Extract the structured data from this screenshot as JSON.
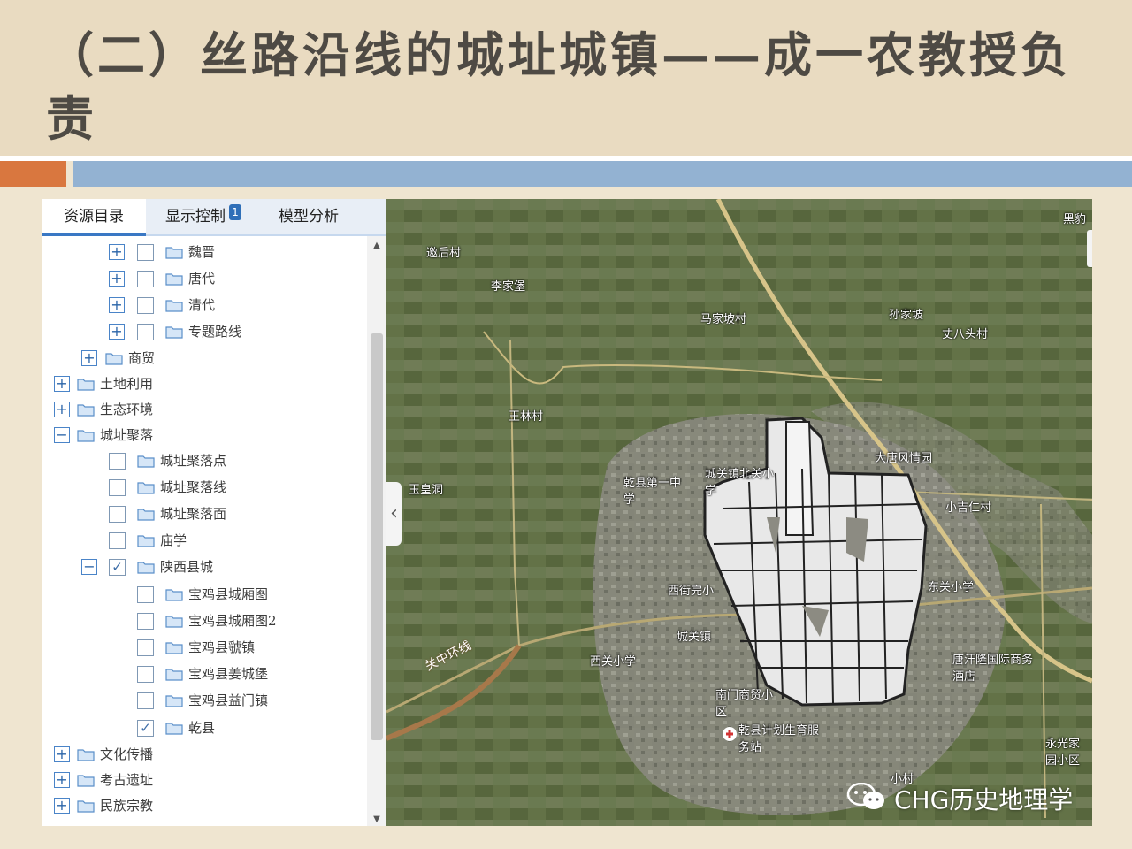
{
  "slide": {
    "title": "（二）丝路沿线的城址城镇——成一农教授负责"
  },
  "panel": {
    "tabs": [
      {
        "label": "资源目录",
        "active": true
      },
      {
        "label": "显示控制",
        "badge": "1"
      },
      {
        "label": "模型分析"
      }
    ],
    "tree": [
      {
        "label": "魏晋",
        "expander": "+",
        "checkbox": true,
        "checked": false
      },
      {
        "label": "唐代",
        "expander": "+",
        "checkbox": true,
        "checked": false
      },
      {
        "label": "清代",
        "expander": "+",
        "checkbox": true,
        "checked": false
      },
      {
        "label": "专题路线",
        "expander": "+",
        "checkbox": true,
        "checked": false
      },
      {
        "label": "商贸",
        "expander": "+",
        "checkbox": false
      },
      {
        "label": "土地利用",
        "expander": "+",
        "checkbox": false
      },
      {
        "label": "生态环境",
        "expander": "+",
        "checkbox": false
      },
      {
        "label": "城址聚落",
        "expander": "−",
        "checkbox": false
      },
      {
        "label": "城址聚落点",
        "checkbox": true,
        "checked": false
      },
      {
        "label": "城址聚落线",
        "checkbox": true,
        "checked": false
      },
      {
        "label": "城址聚落面",
        "checkbox": true,
        "checked": false
      },
      {
        "label": "庙学",
        "checkbox": true,
        "checked": false
      },
      {
        "label": "陕西县城",
        "expander": "−",
        "checkbox": true,
        "checked": true
      },
      {
        "label": "宝鸡县城厢图",
        "checkbox": true,
        "checked": false
      },
      {
        "label": "宝鸡县城厢图2",
        "checkbox": true,
        "checked": false
      },
      {
        "label": "宝鸡县虢镇",
        "checkbox": true,
        "checked": false
      },
      {
        "label": "宝鸡县姜城堡",
        "checkbox": true,
        "checked": false
      },
      {
        "label": "宝鸡县益门镇",
        "checkbox": true,
        "checked": false
      },
      {
        "label": "乾县",
        "checkbox": true,
        "checked": true
      },
      {
        "label": "文化传播",
        "expander": "+",
        "checkbox": false
      },
      {
        "label": "考古遗址",
        "expander": "+",
        "checkbox": false
      },
      {
        "label": "民族宗教",
        "expander": "+",
        "checkbox": false
      }
    ],
    "icons": {
      "folder": "folder-icon",
      "expand": "plus-icon",
      "collapse": "minus-icon",
      "check": "check-icon"
    }
  },
  "map": {
    "labels": {
      "l1": "邀后村",
      "l2": "李家堡",
      "l3": "马家坡村",
      "l4": "孙家坡",
      "l5": "丈八头村",
      "l6": "王林村",
      "l7": "大唐风情园",
      "l8": "玉皇洞",
      "l9": "乾县第一中学",
      "l10": "城关镇北关小学",
      "l11": "小吉仁村",
      "l12": "西街完小",
      "l13": "城关镇",
      "l14": "西关小学",
      "l15": "东关小学",
      "l16": "南门商贸小区",
      "l17": "乾县计划生育服务站",
      "l18": "唐汗隆国际商务酒店",
      "l19": "黑豹",
      "l20": "永光家园小区",
      "l21": "小村"
    },
    "road_label": "关中环线",
    "collapse_glyph": "‹"
  },
  "watermark": {
    "text": "CHG历史地理学",
    "icon": "wechat-icon"
  },
  "colors": {
    "accent_orange": "#d9773f",
    "accent_blue": "#93b2d2",
    "tab_active": "#3a78c4",
    "badge": "#2f6fb8"
  }
}
